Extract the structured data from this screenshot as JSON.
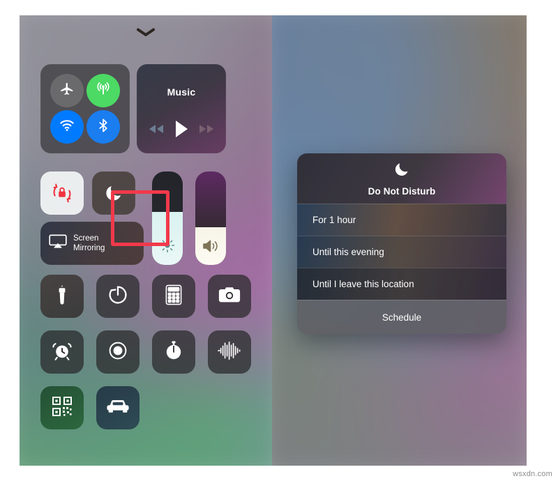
{
  "meta": {
    "watermark": "wsxdn.com",
    "accent_red": "#f2394a",
    "toggle_on_green": "#4cd964",
    "toggle_on_blue": "#007aff",
    "toggle_off_gray": "#808082"
  },
  "left_panel": {
    "handle_icon": "chevron-down-icon",
    "connectivity": {
      "airplane": {
        "icon": "airplane-icon",
        "label": "Airplane Mode",
        "state": "off",
        "color": "#808082"
      },
      "cellular": {
        "icon": "cellular-data-icon",
        "label": "Cellular Data",
        "state": "on",
        "color": "#4cd964"
      },
      "wifi": {
        "icon": "wifi-icon",
        "label": "Wi-Fi",
        "state": "on",
        "color": "#007aff"
      },
      "bluetooth": {
        "icon": "bluetooth-icon",
        "label": "Bluetooth",
        "state": "on",
        "color": "#1a7df0"
      }
    },
    "music": {
      "title": "Music",
      "prev_icon": "rewind-icon",
      "play_icon": "play-icon",
      "next_icon": "fast-forward-icon"
    },
    "rotation_lock": {
      "icon": "rotation-lock-icon",
      "label": "Portrait Orientation Lock",
      "state": "on"
    },
    "do_not_disturb": {
      "icon": "moon-icon",
      "label": "Do Not Disturb",
      "state": "off",
      "highlighted": true
    },
    "screen_mirroring": {
      "icon": "airplay-icon",
      "label_line1": "Screen",
      "label_line2": "Mirroring"
    },
    "brightness": {
      "icon": "brightness-icon",
      "label": "Brightness",
      "value": 57
    },
    "volume": {
      "icon": "volume-icon",
      "label": "Volume",
      "value": 40
    },
    "utilities": [
      {
        "icon": "flashlight-icon",
        "label": "Flashlight",
        "tint": "warm"
      },
      {
        "icon": "timer-icon",
        "label": "Timer",
        "tint": "dark"
      },
      {
        "icon": "calculator-icon",
        "label": "Calculator",
        "tint": "dark"
      },
      {
        "icon": "camera-icon",
        "label": "Camera",
        "tint": "dark"
      },
      {
        "icon": "alarm-clock-icon",
        "label": "Alarm",
        "tint": "dark"
      },
      {
        "icon": "screen-record-icon",
        "label": "Screen Recording",
        "tint": "dark"
      },
      {
        "icon": "stopwatch-icon",
        "label": "Stopwatch",
        "tint": "dark"
      },
      {
        "icon": "voice-memo-icon",
        "label": "Voice Memos",
        "tint": "dark"
      },
      {
        "icon": "qr-code-icon",
        "label": "Scan QR Code",
        "tint": "green"
      },
      {
        "icon": "car-icon",
        "label": "Driving Focus",
        "tint": "blue"
      }
    ]
  },
  "right_panel": {
    "dnd_popup": {
      "icon": "moon-icon",
      "title": "Do Not Disturb",
      "options": [
        "For 1 hour",
        "Until this evening",
        "Until I leave this location"
      ],
      "footer_label": "Schedule"
    }
  }
}
